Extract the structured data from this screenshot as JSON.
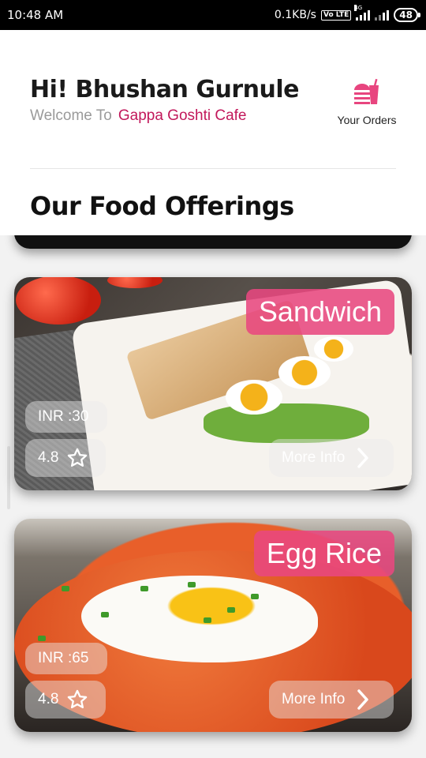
{
  "status_bar": {
    "time": "10:48 AM",
    "network_speed": "0.1KB/s",
    "volte": "Vo LTE",
    "network_type": "4G",
    "battery": "48"
  },
  "header": {
    "greeting": "Hi! Bhushan Gurnule",
    "welcome_prefix": "Welcome To",
    "cafe_name": "Gappa Goshti Cafe",
    "orders_label": "Your Orders",
    "orders_icon": "food-orders-icon"
  },
  "section_title": "Our Food Offerings",
  "colors": {
    "accent": "#c2185b",
    "badge": "#e84880",
    "orders_icon": "#e8457f"
  },
  "items": [
    {
      "name": "Sandwich",
      "price": "INR :30",
      "rating": "4.8",
      "more_label": "More Info"
    },
    {
      "name": "Egg Rice",
      "price": "INR :65",
      "rating": "4.8",
      "more_label": "More Info"
    }
  ]
}
